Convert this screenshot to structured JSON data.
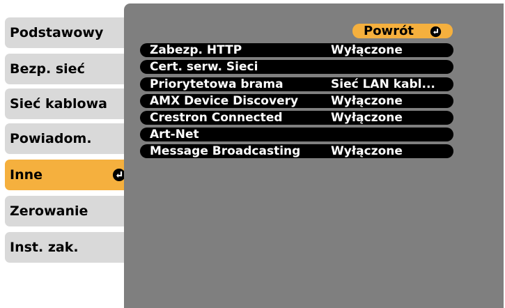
{
  "sidebar": {
    "items": [
      {
        "label": "Podstawowy"
      },
      {
        "label": "Bezp. sieć"
      },
      {
        "label": "Sieć kablowa"
      },
      {
        "label": "Powiadom."
      },
      {
        "label": "Inne",
        "active": true,
        "icon": "enter-icon"
      },
      {
        "label": "Zerowanie"
      },
      {
        "label": "Inst. zak."
      }
    ]
  },
  "panel": {
    "back_button": {
      "label": "Powrót",
      "icon": "enter-icon"
    },
    "rows": [
      {
        "label": "Zabezp. HTTP",
        "value": "Wyłączone"
      },
      {
        "label": "Cert. serw. Sieci",
        "value": ""
      },
      {
        "label": "Priorytetowa brama",
        "value": "Sieć LAN kabl..."
      },
      {
        "label": "AMX Device Discovery",
        "value": "Wyłączone"
      },
      {
        "label": "Crestron Connected",
        "value": "Wyłączone"
      },
      {
        "label": "Art-Net",
        "value": ""
      },
      {
        "label": "Message Broadcasting",
        "value": "Wyłączone"
      }
    ]
  },
  "colors": {
    "tab": "#d9d9d9",
    "active": "#f5b03e",
    "panel": "#7f7f7f",
    "row": "#000000"
  }
}
